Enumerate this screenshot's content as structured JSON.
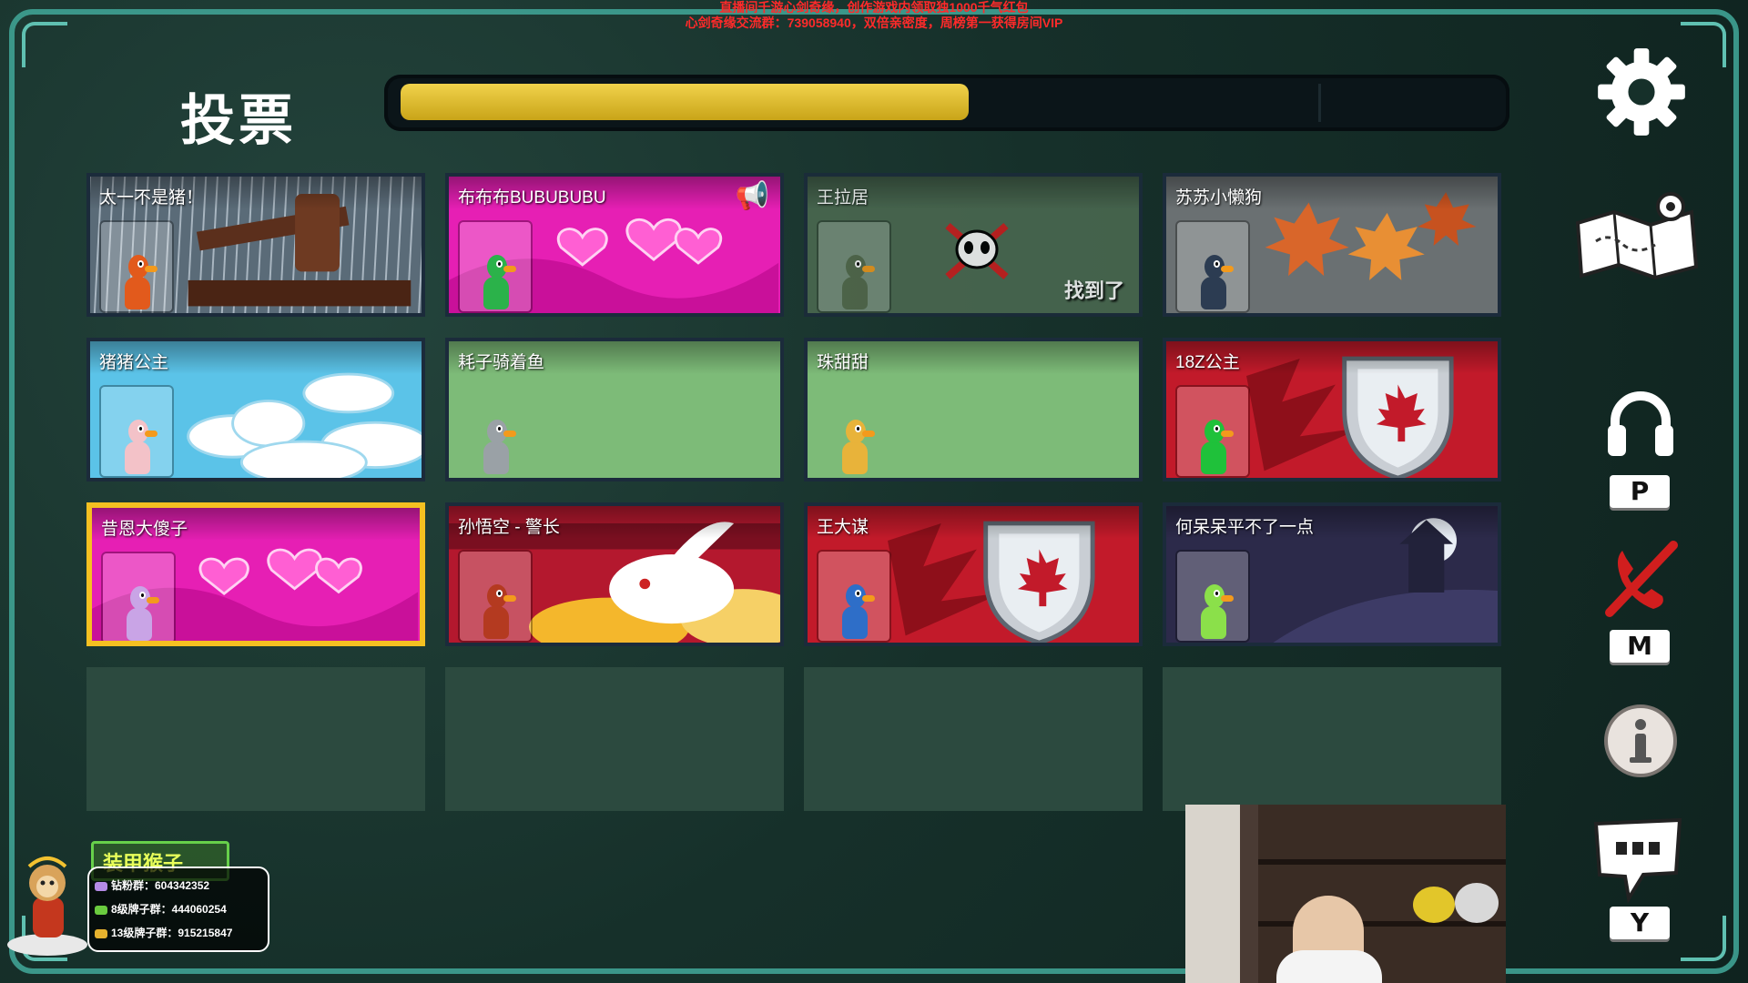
{
  "overlay": {
    "line1": "直播间千游心剑奇缘，创作游戏内领取独1000千气红包",
    "line2": "心剑奇缘交流群：739058940，双倍亲密度，周榜第一获得房间VIP"
  },
  "header": {
    "title": "投票",
    "progress": 0.52
  },
  "players": [
    {
      "name": "太一不是猪！",
      "theme": "gavel",
      "state": "normal",
      "colors": {
        "bg": "#5a6b78",
        "avatar": "#e25a1c"
      }
    },
    {
      "name": "布布布BUBUBUBU",
      "theme": "hearts",
      "state": "speaking",
      "colors": {
        "bg": "#e61fb4",
        "avatar": "#2bb24a"
      }
    },
    {
      "name": "王拉居",
      "theme": "dead",
      "state": "found",
      "status_label": "找到了",
      "colors": {
        "bg": "#4d6b52",
        "avatar": "#556b4d"
      }
    },
    {
      "name": "苏苏小懒狗",
      "theme": "leaves",
      "state": "normal",
      "colors": {
        "bg": "#6a7072",
        "avatar": "#2c3c52"
      }
    },
    {
      "name": "猪猪公主",
      "theme": "clouds",
      "state": "normal",
      "colors": {
        "bg": "#5bc3e8",
        "avatar": "#f3c2c8"
      }
    },
    {
      "name": "耗子骑着鱼",
      "theme": "plain",
      "state": "normal",
      "colors": {
        "bg": "#7dbb78",
        "avatar": "#9aa1a6"
      }
    },
    {
      "name": "珠甜甜",
      "theme": "plain",
      "state": "normal",
      "colors": {
        "bg": "#7dbb78",
        "avatar": "#e8b33a"
      }
    },
    {
      "name": "18Z公主",
      "theme": "canada",
      "state": "normal",
      "colors": {
        "bg": "#c21a2a",
        "avatar": "#1fc13a"
      }
    },
    {
      "name": "昔恩大傻子",
      "theme": "hearts",
      "state": "selected",
      "colors": {
        "bg": "#e61fb4",
        "avatar": "#c9a4e6"
      }
    },
    {
      "name": "孙悟空 - 警长",
      "theme": "rabbit",
      "state": "normal",
      "colors": {
        "bg": "#f4b72c",
        "avatar": "#b43a20"
      }
    },
    {
      "name": "王大谋",
      "theme": "canada",
      "state": "normal",
      "colors": {
        "bg": "#c21a2a",
        "avatar": "#2e6ec8"
      }
    },
    {
      "name": "何呆呆平不了一点",
      "theme": "night",
      "state": "normal",
      "colors": {
        "bg": "#2c2a4a",
        "avatar": "#8be04a"
      }
    }
  ],
  "empty_slots": 4,
  "sidebar": {
    "settings_icon": "gear-icon",
    "map_icon": "map-icon",
    "voice_key": "P",
    "mute_key": "M",
    "chat_key": "Y"
  },
  "streamer": {
    "banner": "装甲猴子",
    "fan_group": "钻粉群：604342352",
    "level8_group": "8级牌子群：444060254",
    "level13_group": "13级牌子群：915215847"
  },
  "accent": "#f5c021"
}
